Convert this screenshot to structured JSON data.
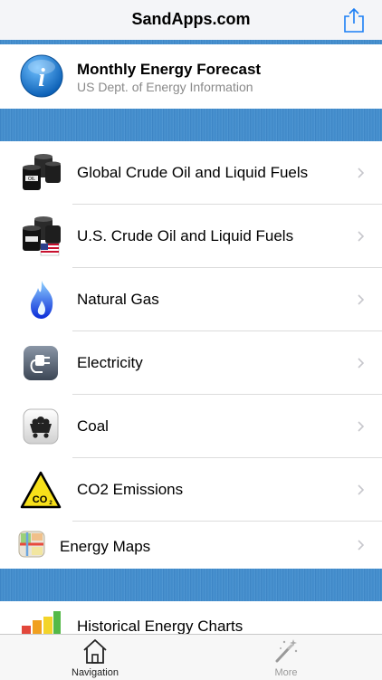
{
  "navbar": {
    "title": "SandApps.com",
    "share_icon": "share-icon"
  },
  "header": {
    "title": "Monthly Energy Forecast",
    "subtitle": "US Dept. of Energy Information",
    "icon": "info-icon"
  },
  "list": [
    {
      "label": "Global Crude Oil and Liquid Fuels",
      "icon": "oil-barrels-icon"
    },
    {
      "label": "U.S. Crude Oil and Liquid Fuels",
      "icon": "us-oil-barrels-icon"
    },
    {
      "label": "Natural Gas",
      "icon": "gas-flame-icon"
    },
    {
      "label": "Electricity",
      "icon": "electric-plug-icon"
    },
    {
      "label": "Coal",
      "icon": "coal-cart-icon"
    },
    {
      "label": "CO2 Emissions",
      "icon": "co2-warning-icon"
    },
    {
      "label": "Energy Maps",
      "icon": "map-icon"
    }
  ],
  "partial": {
    "label": "Historical Energy Charts",
    "icon": "bar-chart-icon"
  },
  "tabbar": {
    "tabs": [
      {
        "label": "Navigation",
        "icon": "home-icon",
        "active": true
      },
      {
        "label": "More",
        "icon": "magic-wand-icon",
        "active": false
      }
    ]
  },
  "colors": {
    "stripe": "#3f89c9",
    "chevron": "#c7c7cc",
    "subtitle": "#8a8a8a"
  }
}
